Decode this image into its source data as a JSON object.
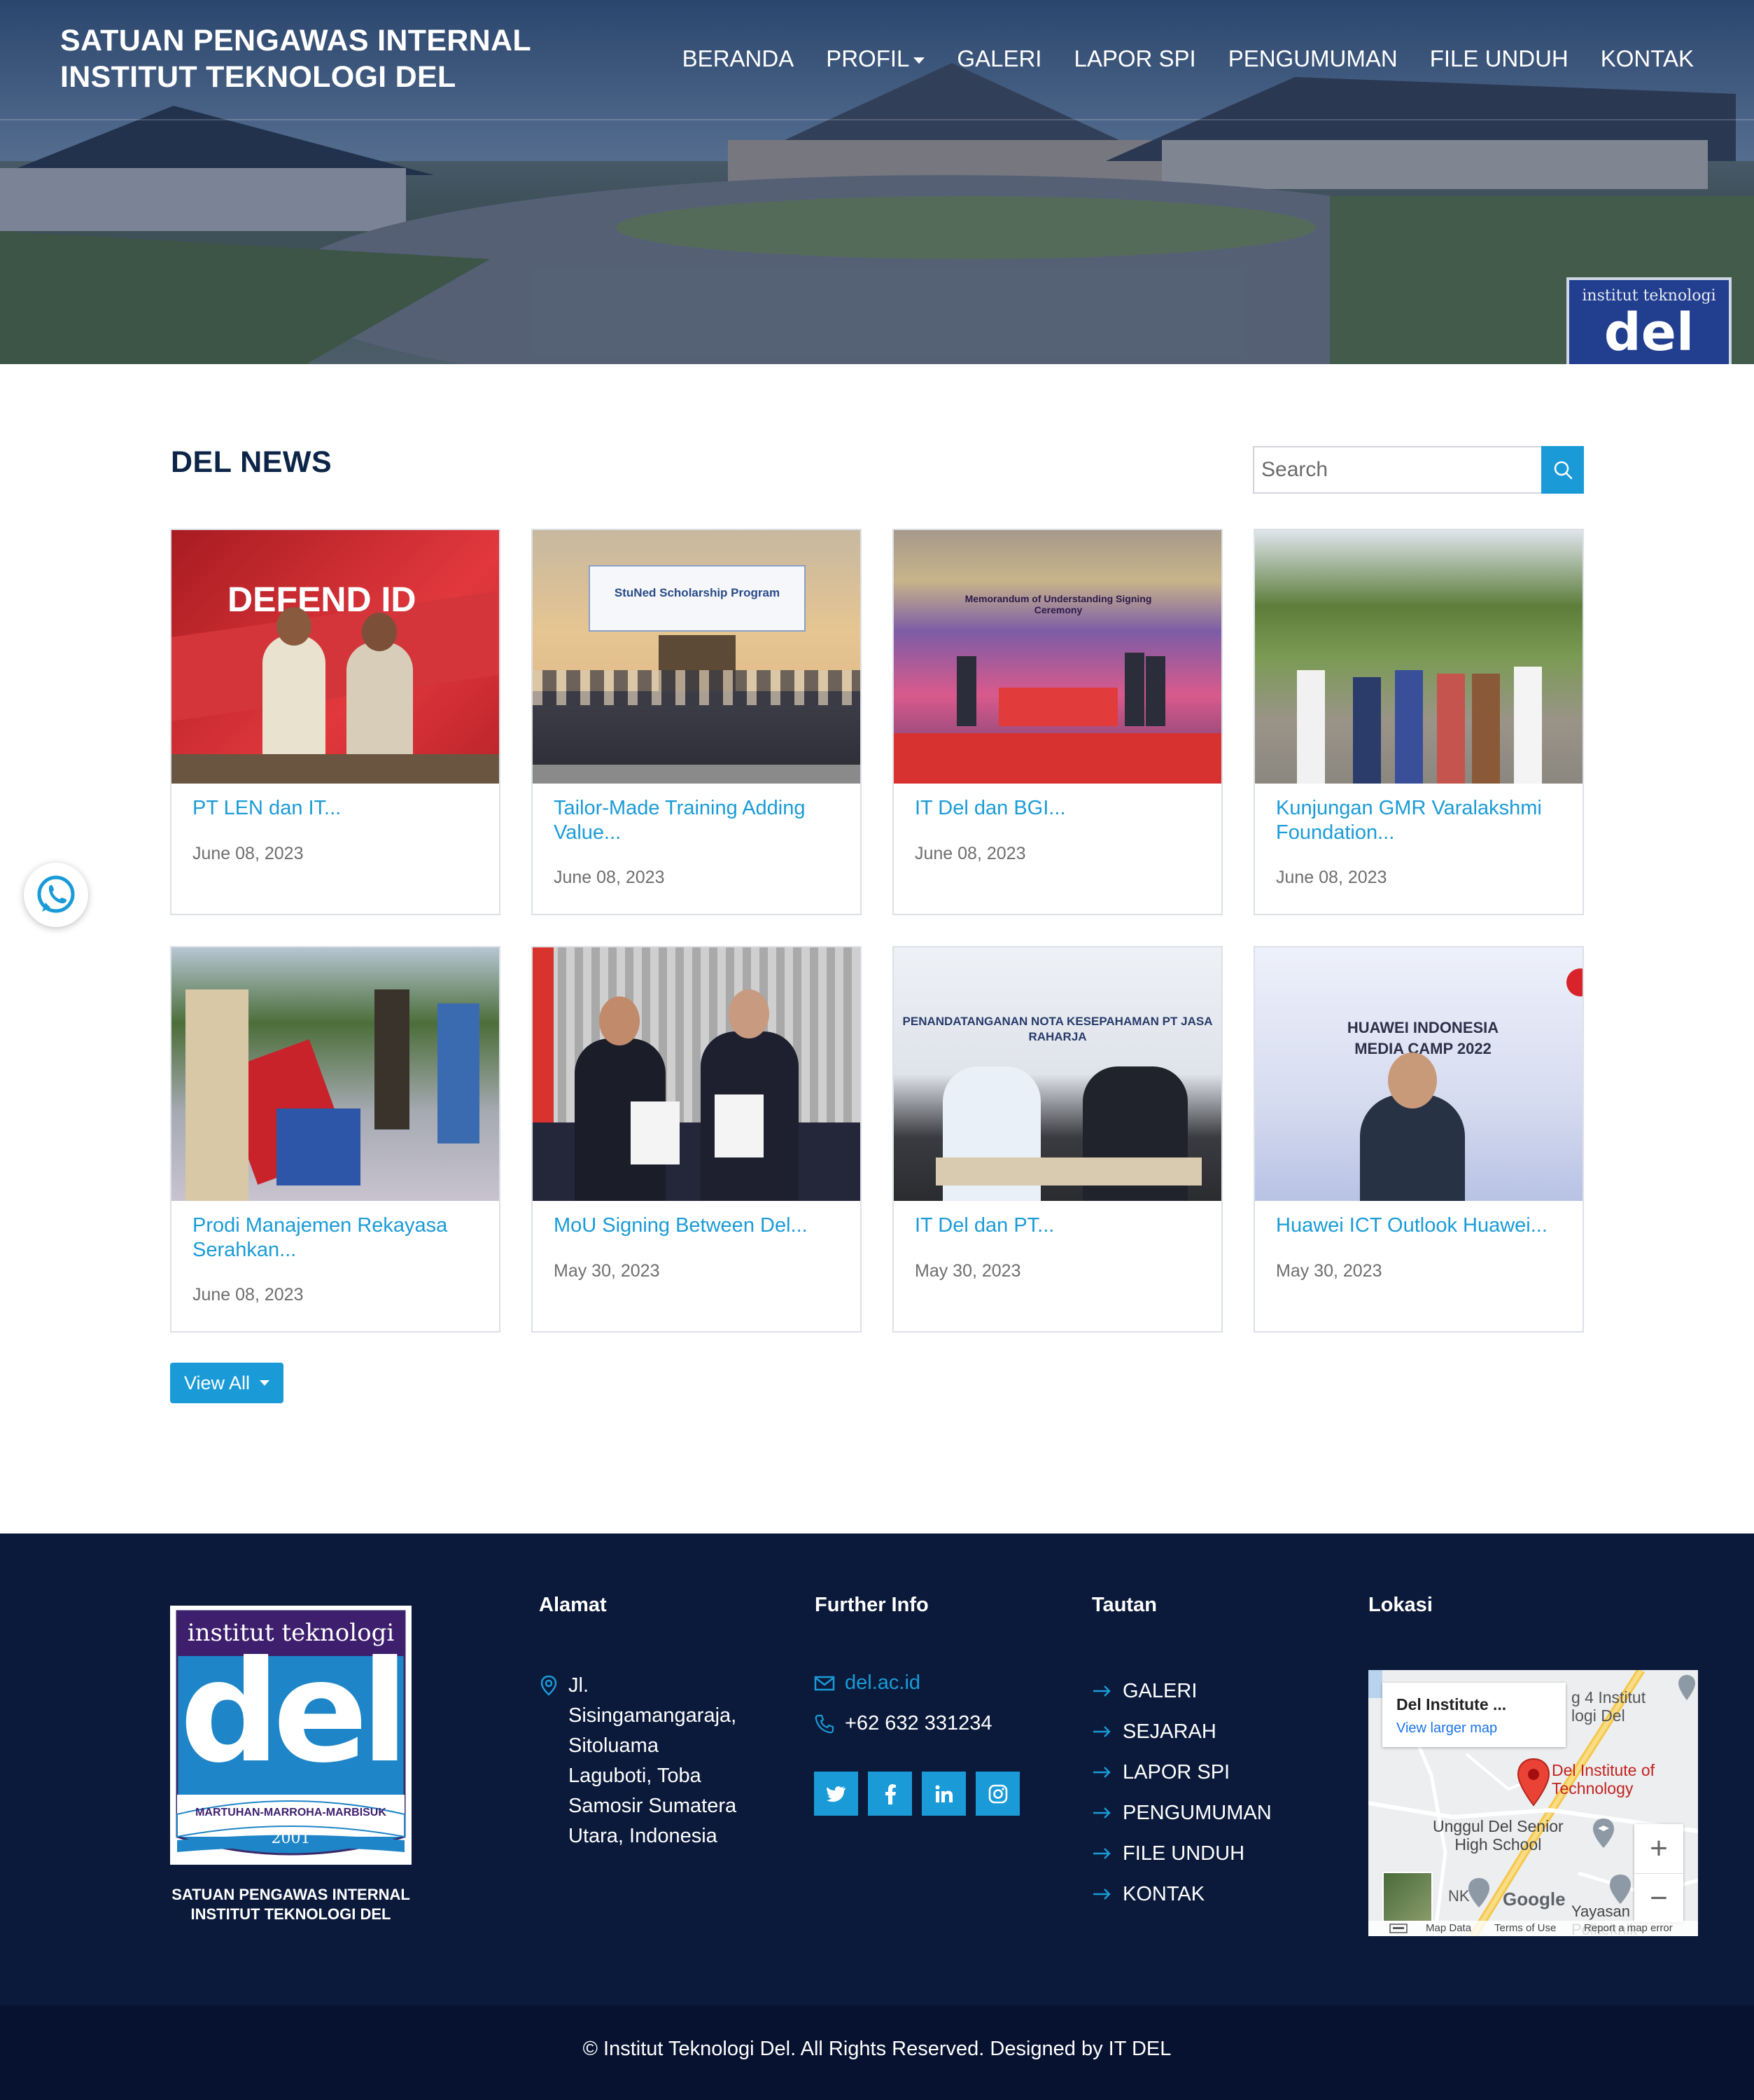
{
  "brand": {
    "line1": "SATUAN PENGAWAS INTERNAL",
    "line2": "INSTITUT TEKNOLOGI DEL"
  },
  "nav": [
    "BERANDA",
    "PROFIL",
    "GALERI",
    "LAPOR SPI",
    "PENGUMUMAN",
    "FILE UNDUH",
    "KONTAK"
  ],
  "hero": {
    "sign_text": "institut teknologi",
    "sign_word": "del"
  },
  "news": {
    "title": "DEL NEWS",
    "search_placeholder": "Search",
    "view_all": "View All",
    "cards": [
      {
        "title": "PT LEN dan IT...",
        "date": "June 08, 2023",
        "image_text": "DEFEND ID"
      },
      {
        "title": "Tailor-Made Training Adding Value...",
        "date": "June 08, 2023",
        "image_text": "StuNed Scholarship Program"
      },
      {
        "title": "IT Del dan BGI...",
        "date": "June 08, 2023",
        "image_text": "Memorandum of Understanding Signing Ceremony"
      },
      {
        "title": "Kunjungan GMR Varalakshmi Foundation...",
        "date": "June 08, 2023",
        "image_text": ""
      },
      {
        "title": "Prodi Manajemen Rekayasa Serahkan...",
        "date": "June 08, 2023",
        "image_text": ""
      },
      {
        "title": "MoU Signing Between Del...",
        "date": "May 30, 2023",
        "image_text": ""
      },
      {
        "title": "IT Del dan PT...",
        "date": "May 30, 2023",
        "image_text": "PENANDATANGANAN NOTA KESEPAHAMAN PT JASA RAHARJA"
      },
      {
        "title": "Huawei ICT Outlook Huawei...",
        "date": "May 30, 2023",
        "image_text": "HUAWEI INDONESIA MEDIA CAMP 2022"
      }
    ]
  },
  "footer": {
    "logo_top": "institut teknologi",
    "logo_word": "del",
    "logo_motto": "MARTUHAN-MARROHA-MARBISUK",
    "logo_year": "2001",
    "caption1": "SATUAN PENGAWAS INTERNAL",
    "caption2": "INSTITUT TEKNOLOGI DEL",
    "alamat_title": "Alamat",
    "address": [
      "Jl.",
      "Sisingamangaraja,",
      "Sitoluama",
      "Laguboti, Toba",
      "Samosir Sumatera",
      "Utara, Indonesia"
    ],
    "info_title": "Further Info",
    "website": "del.ac.id",
    "phone": "+62 632 331234",
    "socials": [
      "twitter-icon",
      "facebook-icon",
      "linkedin-icon",
      "instagram-icon"
    ],
    "links_title": "Tautan",
    "links": [
      "GALERI",
      "SEJARAH",
      "LAPOR SPI",
      "PENGUMUMAN",
      "FILE UNDUH",
      "KONTAK"
    ],
    "map_title": "Lokasi",
    "map": {
      "place": "Del Institute ...",
      "larger": "View larger map",
      "pin_label1": "Del Institute of",
      "pin_label2": "Technology",
      "school1": "Unggul Del Senior",
      "school2": "High School",
      "top_label1": "g 4 Institut",
      "top_label2": "logi Del",
      "nk": "NK",
      "google": "Google",
      "polite": "Yayasan Politeknik",
      "map_data": "Map Data",
      "terms": "Terms of Use",
      "report": "Report a map error",
      "zoom_in": "+",
      "zoom_out": "−"
    },
    "copyright": "© Institut Teknologi Del. All Rights Reserved. Designed by IT DEL"
  },
  "colors": {
    "accent": "#1a9bd7",
    "footer_bg": "#0b1a3b",
    "bottom_bg": "#071230",
    "heading": "#0c2547"
  }
}
